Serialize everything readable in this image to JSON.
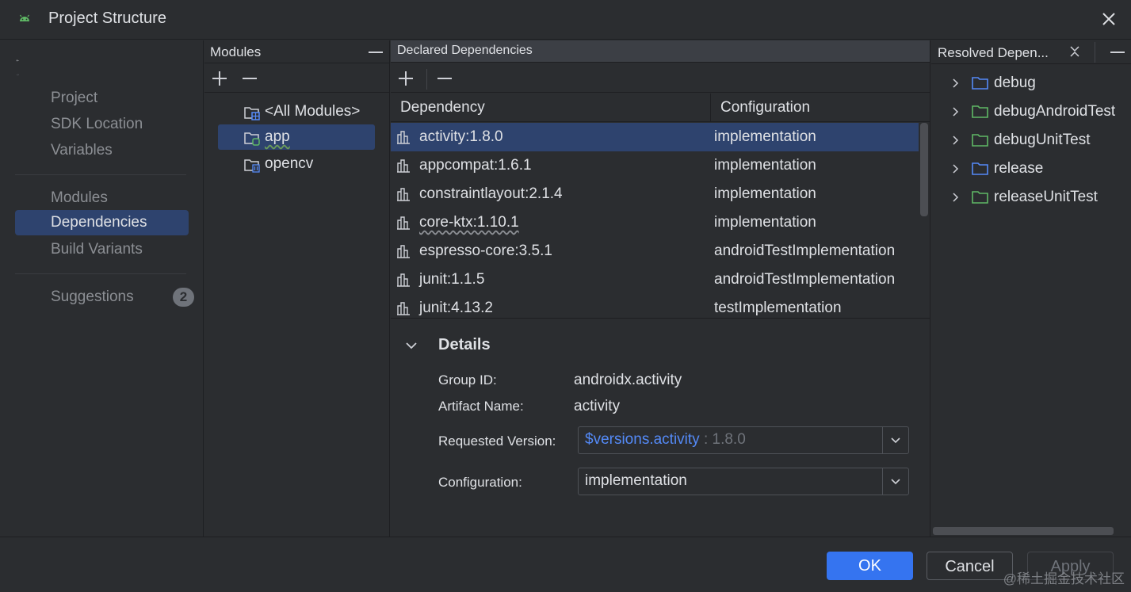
{
  "window": {
    "title": "Project Structure"
  },
  "nav": {
    "items_group1": [
      "Project",
      "SDK Location",
      "Variables"
    ],
    "items_group2": [
      "Modules",
      "Dependencies",
      "Build Variants"
    ],
    "suggestions": {
      "label": "Suggestions",
      "count": "2"
    },
    "active": "Dependencies"
  },
  "modules": {
    "title": "Modules",
    "items": [
      "<All Modules>",
      "app",
      "opencv"
    ],
    "selected": "app"
  },
  "declared": {
    "title": "Declared Dependencies",
    "columns": [
      "Dependency",
      "Configuration"
    ],
    "rows": [
      {
        "name": "activity:1.8.0",
        "config": "implementation"
      },
      {
        "name": "appcompat:1.6.1",
        "config": "implementation"
      },
      {
        "name": "constraintlayout:2.1.4",
        "config": "implementation"
      },
      {
        "name": "core-ktx:1.10.1",
        "config": "implementation"
      },
      {
        "name": "espresso-core:3.5.1",
        "config": "androidTestImplementation"
      },
      {
        "name": "junit:1.1.5",
        "config": "androidTestImplementation"
      },
      {
        "name": "junit:4.13.2",
        "config": "testImplementation"
      }
    ]
  },
  "details": {
    "title": "Details",
    "group_id_label": "Group ID:",
    "group_id": "androidx.activity",
    "artifact_label": "Artifact Name:",
    "artifact": "activity",
    "requested_label": "Requested Version:",
    "requested_var": "$versions.activity",
    "requested_ver": " : 1.8.0",
    "configuration_label": "Configuration:",
    "configuration": "implementation"
  },
  "resolved": {
    "title": "Resolved Depen...",
    "items": [
      {
        "label": "debug",
        "color": "#548af7"
      },
      {
        "label": "debugAndroidTest",
        "color": "#5fb865"
      },
      {
        "label": "debugUnitTest",
        "color": "#5fb865"
      },
      {
        "label": "release",
        "color": "#548af7"
      },
      {
        "label": "releaseUnitTest",
        "color": "#5fb865"
      }
    ]
  },
  "footer": {
    "ok": "OK",
    "cancel": "Cancel",
    "apply": "Apply",
    "watermark": "@稀土掘金技术社区"
  },
  "colors": {
    "accent": "#3574f0",
    "selection": "#2e436e",
    "background": "#2b2d30"
  }
}
